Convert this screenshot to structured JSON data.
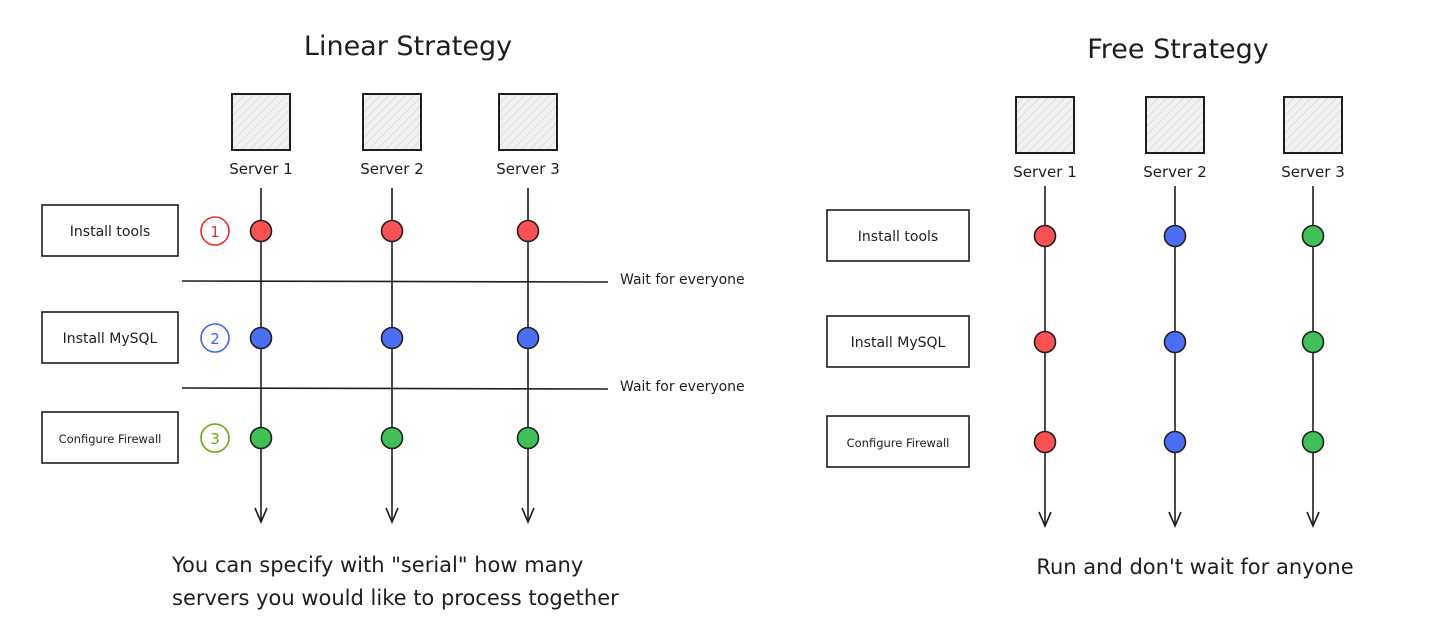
{
  "colors": {
    "red": "#fa5252",
    "blue": "#4c6ef5",
    "green": "#40c057",
    "ink": "#1e1e1e",
    "num_red": "#e03131",
    "num_blue": "#4263eb",
    "num_green": "#66a80f"
  },
  "servers": [
    "Server 1",
    "Server 2",
    "Server 3"
  ],
  "tasks": [
    "Install tools",
    "Install MySQL",
    "Configure Firewall"
  ],
  "linear": {
    "title": "Linear Strategy",
    "step_numbers": [
      "1",
      "2",
      "3"
    ],
    "wait_label": "Wait for everyone",
    "dot_colors_by_task": [
      "red",
      "blue",
      "green"
    ],
    "caption_lines": [
      "You can specify with \"serial\" how many",
      "servers you would like to process together"
    ]
  },
  "free": {
    "title": "Free Strategy",
    "dot_colors_by_server": [
      "red",
      "blue",
      "green"
    ],
    "caption": "Run and don't wait for anyone"
  }
}
